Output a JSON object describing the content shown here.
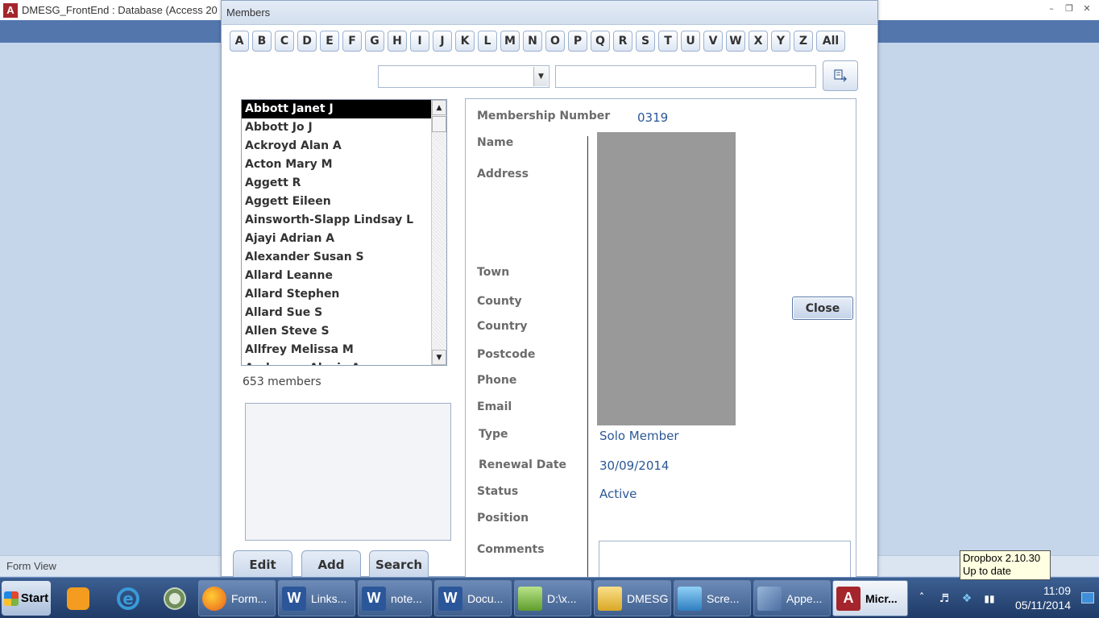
{
  "app": {
    "icon_letter": "A",
    "title": "DMESG_FrontEnd : Database (Access 20",
    "status": "Form View",
    "window_controls": [
      "minimize-icon",
      "restore-icon",
      "close-icon"
    ]
  },
  "form": {
    "title": "Members",
    "letters": [
      "A",
      "B",
      "C",
      "D",
      "E",
      "F",
      "G",
      "H",
      "I",
      "J",
      "K",
      "L",
      "M",
      "N",
      "O",
      "P",
      "Q",
      "R",
      "S",
      "T",
      "U",
      "V",
      "W",
      "X",
      "Y",
      "Z",
      "All"
    ],
    "search_button_icon": "find-icon",
    "members": [
      "Abbott Janet J",
      "Abbott Jo J",
      "Ackroyd Alan A",
      "Acton Mary M",
      "Aggett  R",
      "Aggett Eileen",
      "Ainsworth-Slapp Lindsay L",
      "Ajayi Adrian A",
      "Alexander Susan S",
      "Allard Leanne",
      "Allard Stephen",
      "Allard Sue S",
      "Allen Steve S",
      "Allfrey Melissa M",
      "Anderson Alexis A"
    ],
    "member_count": "653 members",
    "buttons": {
      "edit": "Edit",
      "add": "Add",
      "search": "Search",
      "close": "Close"
    }
  },
  "details": {
    "labels": {
      "membership_number": "Membership Number",
      "name": "Name",
      "address": "Address",
      "town": "Town",
      "county": "County",
      "country": "Country",
      "postcode": "Postcode",
      "phone": "Phone",
      "email": "Email",
      "type": "Type",
      "renewal_date": "Renewal Date",
      "status": "Status",
      "position": "Position",
      "comments": "Comments"
    },
    "values": {
      "membership_number": "0319",
      "type": "Solo Member",
      "renewal_date": "30/09/2014",
      "status": "Active"
    }
  },
  "tooltip": {
    "line1": "Dropbox 2.10.30",
    "line2": "Up to date"
  },
  "taskbar": {
    "start": "Start",
    "items": [
      {
        "label": "Form...",
        "icon": "firefox-icon"
      },
      {
        "label": "Links...",
        "icon": "word-icon"
      },
      {
        "label": "note...",
        "icon": "word-icon"
      },
      {
        "label": "Docu...",
        "icon": "word-icon"
      },
      {
        "label": "D:\\x...",
        "icon": "notepad-icon"
      },
      {
        "label": "DMESG",
        "icon": "folder-icon"
      },
      {
        "label": "Scre...",
        "icon": "screen-icon"
      },
      {
        "label": "Appe...",
        "icon": "app-icon"
      },
      {
        "label": "Micr...",
        "icon": "access-icon"
      }
    ],
    "clock_time": "11:09",
    "clock_date": "05/11/2014"
  }
}
